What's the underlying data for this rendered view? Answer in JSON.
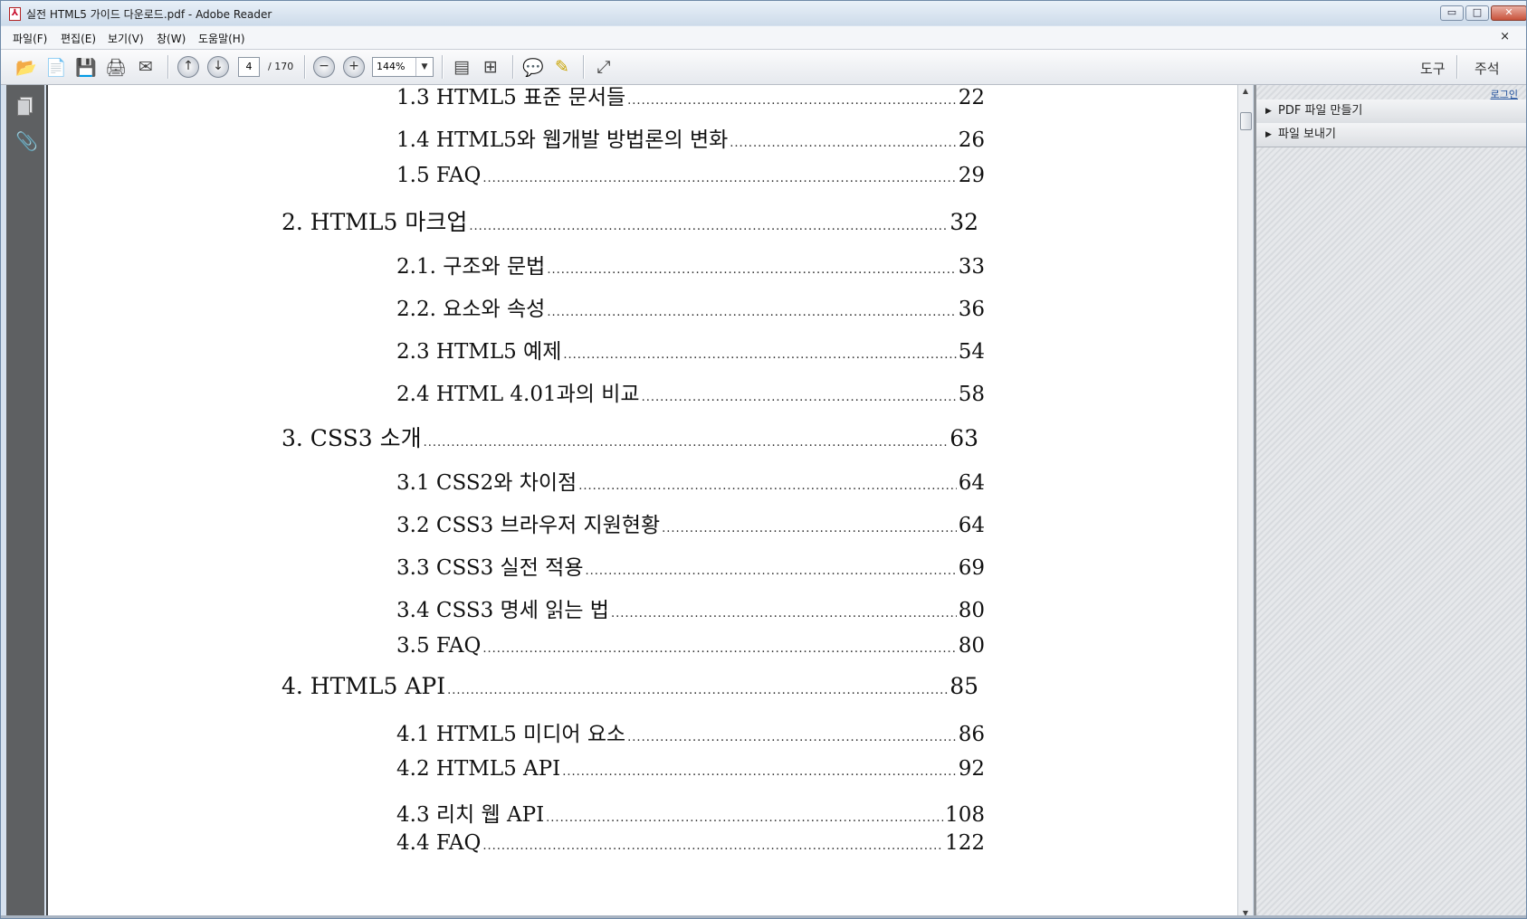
{
  "window": {
    "title": "실전 HTML5 가이드 다운로드.pdf - Adobe Reader",
    "minimize": "▭",
    "maximize": "□",
    "close": "✕"
  },
  "menu": {
    "items": [
      "파일(F)",
      "편집(E)",
      "보기(V)",
      "창(W)",
      "도움말(H)"
    ],
    "close": "×"
  },
  "toolbar": {
    "page_current": "4",
    "page_total": "/ 170",
    "zoom": "144%",
    "tools_label": "도구",
    "comment_label": "주석"
  },
  "right_panel": {
    "login": "로그인",
    "sections": [
      "PDF 파일 만들기",
      "파일 보내기"
    ]
  },
  "document": {
    "toc": [
      {
        "level": 2,
        "title": "1.3 HTML5 표준 문서들 ",
        "page": "22"
      },
      {
        "level": 2,
        "title": "1.4 HTML5와 웹개발 방법론의 변화",
        "page": "26"
      },
      {
        "level": 2,
        "title": "1.5 FAQ",
        "page": "29"
      },
      {
        "level": 1,
        "title": "2. HTML5 마크업",
        "page": "32"
      },
      {
        "level": 2,
        "title": "2.1. 구조와 문법 ",
        "page": "33"
      },
      {
        "level": 2,
        "title": "2.2. 요소와 속성 ",
        "page": "36"
      },
      {
        "level": 2,
        "title": "2.3 HTML5 예제",
        "page": "54"
      },
      {
        "level": 2,
        "title": "2.4 HTML 4.01과의 비교",
        "page": "58"
      },
      {
        "level": 1,
        "title": "3. CSS3 소개 ",
        "page": "63"
      },
      {
        "level": 2,
        "title": "3.1 CSS2와 차이점",
        "page": "64"
      },
      {
        "level": 2,
        "title": "3.2 CSS3 브라우저 지원현황",
        "page": "64"
      },
      {
        "level": 2,
        "title": "3.3 CSS3 실전 적용 ",
        "page": "69"
      },
      {
        "level": 2,
        "title": "3.4 CSS3 명세 읽는 법 ",
        "page": "80"
      },
      {
        "level": 2,
        "title": "3.5 FAQ",
        "page": "80"
      },
      {
        "level": 1,
        "title": "4. HTML5 API",
        "page": "85"
      },
      {
        "level": 2,
        "title": "4.1 HTML5 미디어 요소",
        "page": "86"
      },
      {
        "level": 2,
        "title": "4.2 HTML5 API",
        "page": "92"
      },
      {
        "level": 2,
        "title": "4.3 리치 웹 API",
        "page": "108"
      },
      {
        "level": 2,
        "title": "4.4 FAQ",
        "page": "122"
      }
    ]
  }
}
